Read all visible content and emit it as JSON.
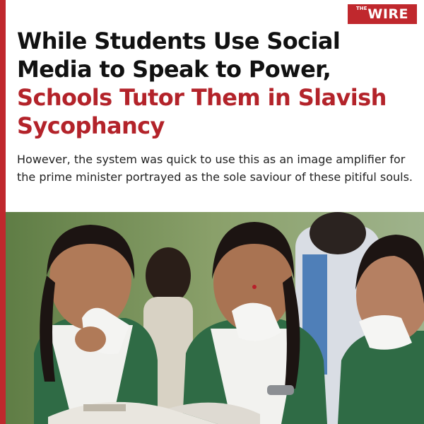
{
  "logo": {
    "prefix": "THE",
    "name": "WIRE"
  },
  "headline": {
    "part1": "While Students Use Social Media to Speak to Power, ",
    "part2": "Schools Tutor Them in Slavish Sycophancy"
  },
  "subhead": "However, the system was quick to use this as an image amplifier for the prime minister portrayed as the sole saviour of these pitiful souls.",
  "colors": {
    "accent": "#c0282d",
    "headline_accent": "#b3232a",
    "text": "#111111"
  },
  "icons": [
    "the-wire-logo"
  ]
}
